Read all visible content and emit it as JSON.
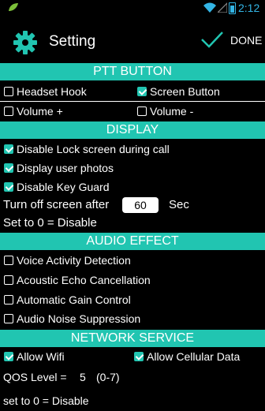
{
  "status": {
    "time": "2:12"
  },
  "header": {
    "title": "Setting",
    "done_label": "DONE"
  },
  "ptt": {
    "title": "PTT BUTTON",
    "items": [
      {
        "label": "Headset Hook",
        "checked": false
      },
      {
        "label": "Screen Button",
        "checked": true
      },
      {
        "label": "Volume +",
        "checked": false
      },
      {
        "label": "Volume -",
        "checked": false
      }
    ]
  },
  "display": {
    "title": "DISPLAY",
    "items": [
      {
        "label": "Disable Lock screen during call",
        "checked": true
      },
      {
        "label": "Display user photos",
        "checked": true
      },
      {
        "label": "Disable Key Guard",
        "checked": true
      }
    ],
    "turn_off_label": "Turn off screen after",
    "turn_off_value": "60",
    "turn_off_unit": "Sec",
    "note": "Set to 0 = Disable"
  },
  "audio": {
    "title": "AUDIO EFFECT",
    "items": [
      {
        "label": "Voice Activity Detection",
        "checked": false
      },
      {
        "label": "Acoustic Echo Cancellation",
        "checked": false
      },
      {
        "label": "Automatic Gain Control",
        "checked": false
      },
      {
        "label": "Audio Noise Suppression",
        "checked": false
      }
    ]
  },
  "network": {
    "title": "NETWORK SERVICE",
    "items": [
      {
        "label": "Allow Wifi",
        "checked": true
      },
      {
        "label": "Allow Cellular Data",
        "checked": true
      }
    ],
    "qos_label": "QOS Level =",
    "qos_value": "5",
    "qos_range": "(0-7)",
    "note": "set to 0 = Disable"
  },
  "colors": {
    "accent": "#21c5b1",
    "status_blue": "#33b5e5"
  }
}
